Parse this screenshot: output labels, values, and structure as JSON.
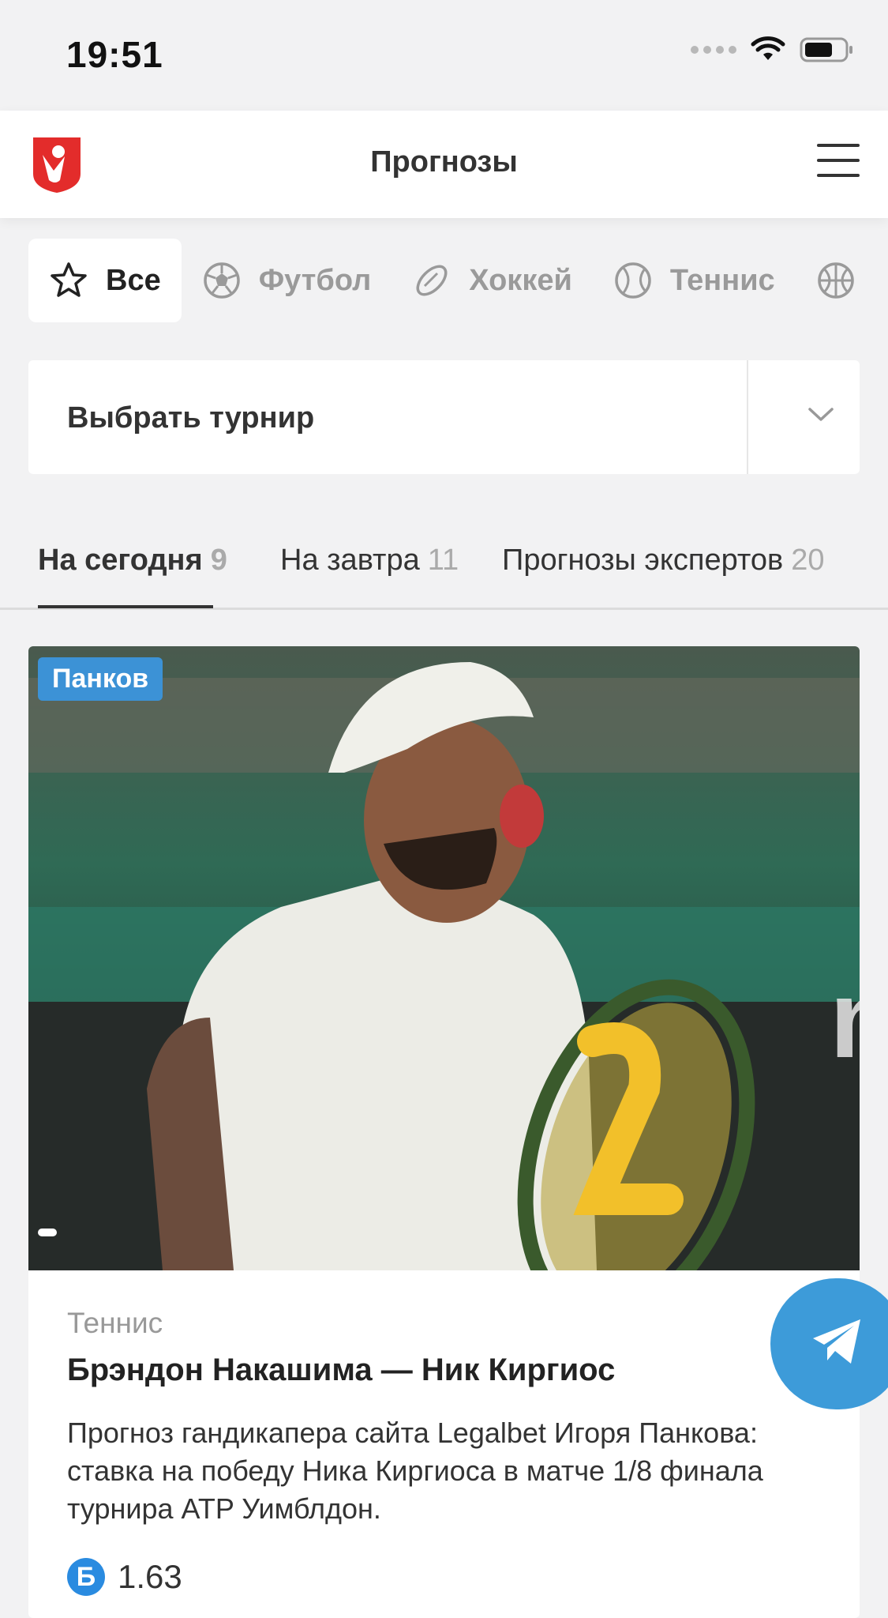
{
  "status_bar": {
    "time": "19:51"
  },
  "header": {
    "title": "Прогнозы"
  },
  "sport_tabs": [
    {
      "label": "Все",
      "icon": "star-icon",
      "active": true
    },
    {
      "label": "Футбол",
      "icon": "soccer-ball-icon"
    },
    {
      "label": "Хоккей",
      "icon": "hockey-puck-icon"
    },
    {
      "label": "Теннис",
      "icon": "tennis-ball-icon"
    },
    {
      "label": "",
      "icon": "basketball-icon"
    }
  ],
  "tournament_select": {
    "label": "Выбрать турнир"
  },
  "date_tabs": [
    {
      "label": "На сегодня",
      "count": "9",
      "active": true
    },
    {
      "label": "На завтра",
      "count": "11"
    },
    {
      "label": "Прогнозы экспертов",
      "count": "20"
    }
  ],
  "card": {
    "author": "Панков",
    "sport": "Теннис",
    "title": "Брэндон Накашима — Ник Киргиос",
    "description": "Прогноз гандикапера сайта Legalbet Игоря Панкова: ставка на победу Ника Киргиоса в матче 1/8 финала турнира ATP Уимблдон.",
    "bookmaker_icon": "Б",
    "odds": "1.63"
  },
  "colors": {
    "accent_blue": "#3c92d6",
    "logo_red": "#e32c2b",
    "background": "#f2f2f3"
  }
}
